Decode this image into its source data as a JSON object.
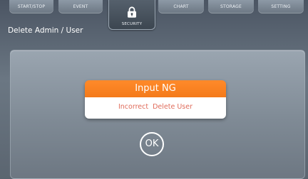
{
  "nav": {
    "tabs": [
      {
        "id": "start-stop",
        "label": "START/STOP"
      },
      {
        "id": "event",
        "label": "EVENT"
      },
      {
        "id": "security",
        "label": "SECURITY",
        "icon": "lock-icon",
        "active": true
      },
      {
        "id": "chart",
        "label": "CHART"
      },
      {
        "id": "storage",
        "label": "STORAGE"
      },
      {
        "id": "setting",
        "label": "SETTING"
      }
    ]
  },
  "page": {
    "title": "Delete Admin / User"
  },
  "dialog": {
    "title": "Input NG",
    "message": "Incorrect  Delete User",
    "ok_label": "OK"
  },
  "colors": {
    "accent": "#f47a1a",
    "message_text": "#e06b5a"
  }
}
